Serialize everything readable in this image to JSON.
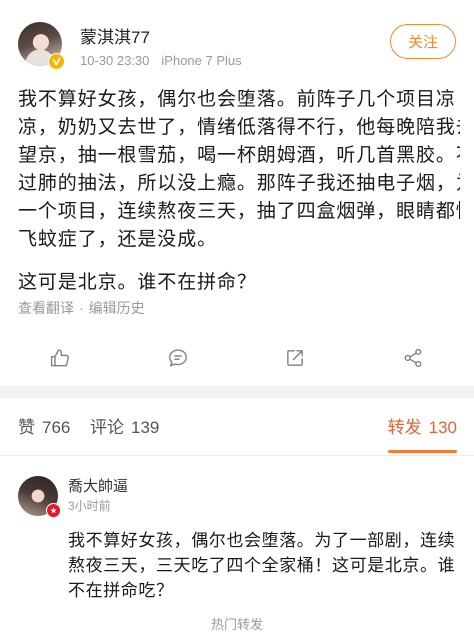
{
  "post": {
    "author": {
      "name": "蒙淇淇77",
      "badge_icon": "verified-badge-icon"
    },
    "meta": {
      "time": "10-30 23:30",
      "source": "iPhone 7 Plus"
    },
    "follow_label": "关注",
    "paragraphs": [
      [
        "我不算好女孩，偶尔也会堕落。前阵子几个项目凉",
        "凉，奶奶又去世了，情绪低落得不行，他每晚陪我去",
        "望京，抽一根雪茄，喝一杯朗姆酒，听几首黑胶。不",
        "过肺的抽法，所以没上瘾。那阵子我还抽电子烟，为",
        "一个项目，连续熬夜三天，抽了四盒烟弹，眼睛都快",
        "飞蚊症了，还是没成。"
      ],
      [
        "这可是北京。谁不在拼命？"
      ]
    ],
    "links": {
      "translate": "查看翻译",
      "separator": "·",
      "edit_history": "编辑历史"
    }
  },
  "actions": [
    {
      "key": "like",
      "icon": "thumb-up-icon"
    },
    {
      "key": "comment",
      "icon": "comment-icon"
    },
    {
      "key": "repost",
      "icon": "repost-icon"
    },
    {
      "key": "share",
      "icon": "share-icon"
    }
  ],
  "stats": {
    "likes_label": "赞",
    "likes": 766,
    "comments_label": "评论",
    "comments": 139,
    "reposts_label": "转发",
    "reposts": 130,
    "active_tab": "reposts"
  },
  "reposts": [
    {
      "name": "喬大帥逼",
      "badge_icon": "member-badge-icon",
      "time": "3小时前",
      "lines": [
        "我不算好女孩，偶尔也会堕落。为了一部剧，连续",
        "熬夜三天，三天吃了四个全家桶！这可是北京。谁",
        "不在拼命吃？"
      ]
    }
  ],
  "footer": {
    "section_title": "热门转发"
  },
  "colors": {
    "accent": "#f18a33",
    "active_tab": "#ec6135",
    "indicator": "#f47c35",
    "text": "#1a1a1a",
    "muted": "#999999",
    "icon": "#7f7f7f",
    "verified_badge": "#f7b500",
    "member_badge": "#e6162d"
  }
}
